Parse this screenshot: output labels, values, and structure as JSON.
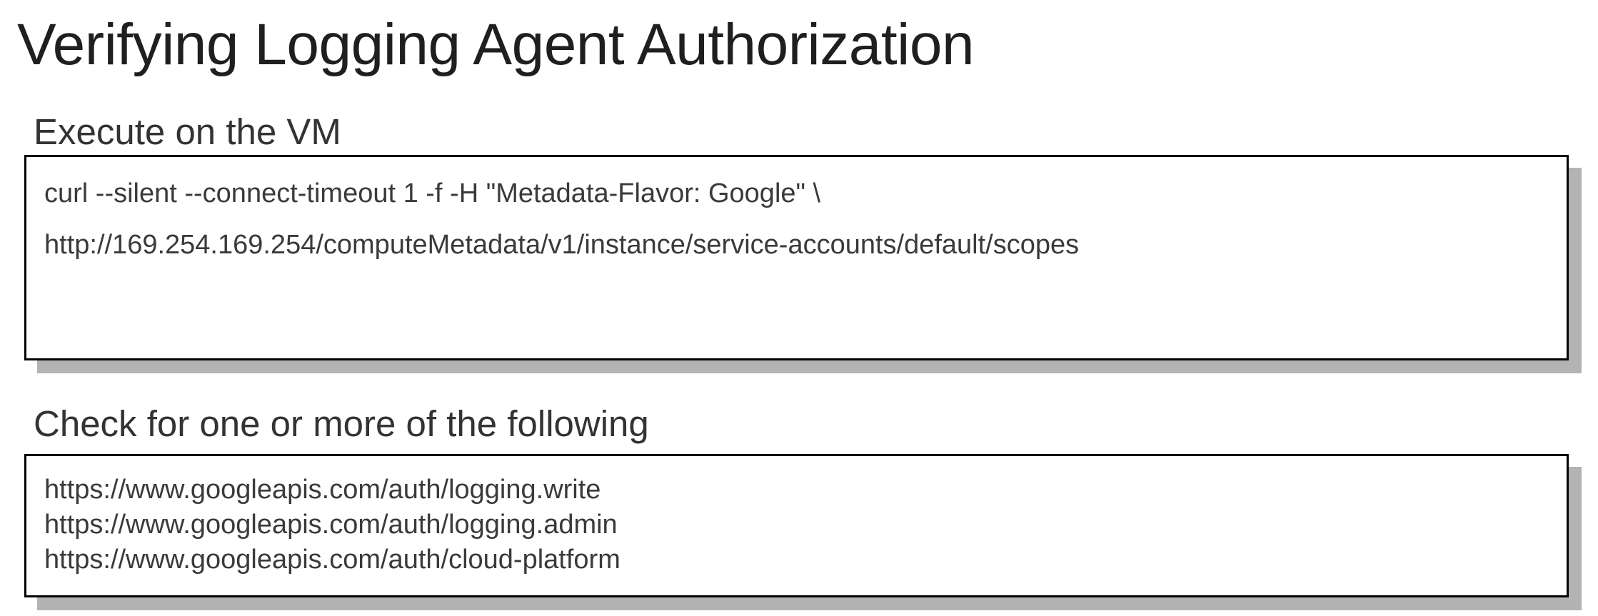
{
  "page": {
    "title": "Verifying Logging Agent Authorization"
  },
  "execute_section": {
    "label": "Execute on the VM",
    "command_lines": [
      "curl --silent --connect-timeout 1 -f -H \"Metadata-Flavor: Google\" \\",
      "http://169.254.169.254/computeMetadata/v1/instance/service-accounts/default/scopes"
    ]
  },
  "check_section": {
    "label": "Check for one or more of the following",
    "scopes": [
      "https://www.googleapis.com/auth/logging.write",
      "https://www.googleapis.com/auth/logging.admin",
      "https://www.googleapis.com/auth/cloud-platform"
    ]
  },
  "colors": {
    "border": "#000000",
    "shadow": "#b3b3b3",
    "text": "#3a3a3a",
    "title": "#1f1f1f"
  }
}
